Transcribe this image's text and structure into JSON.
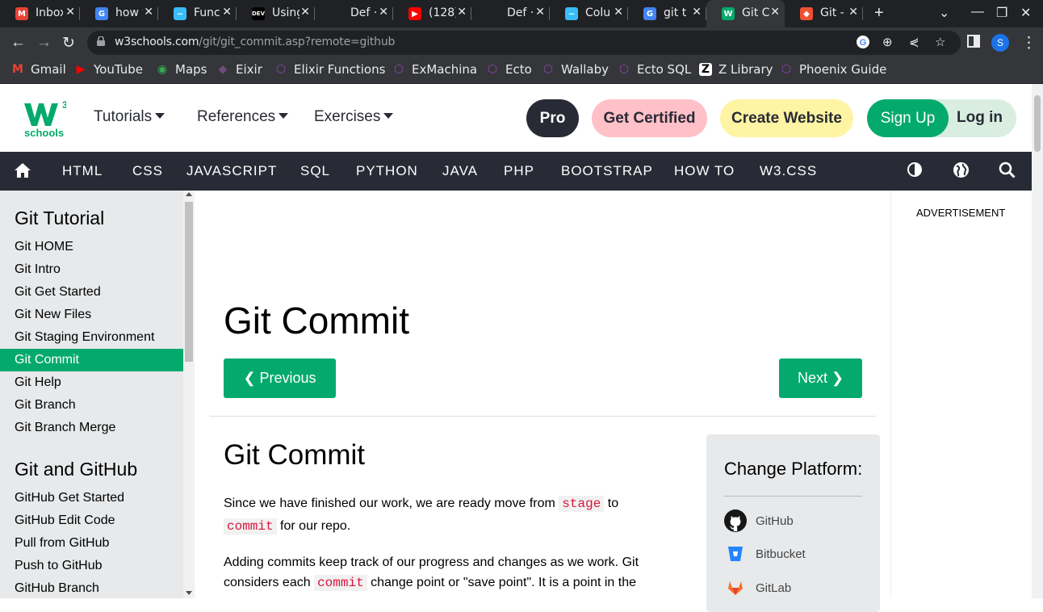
{
  "browser": {
    "tabs": [
      {
        "title": "Inbox",
        "favicon": "gmail-icon",
        "color": "#ea4335",
        "glyph": "M"
      },
      {
        "title": "how t",
        "favicon": "google-icon",
        "color": "#4285f4",
        "glyph": "G"
      },
      {
        "title": "Func",
        "favicon": "tailwind-icon",
        "color": "#38bdf8",
        "glyph": "~"
      },
      {
        "title": "Using",
        "favicon": "dev-icon",
        "color": "#000000",
        "glyph": "DEV"
      },
      {
        "title": "Def ·",
        "favicon": "blank-icon",
        "color": "#202124",
        "glyph": ""
      },
      {
        "title": "(128)",
        "favicon": "youtube-icon",
        "color": "#ff0000",
        "glyph": "▶"
      },
      {
        "title": "Def ·",
        "favicon": "blank-icon",
        "color": "#202124",
        "glyph": ""
      },
      {
        "title": "Colu",
        "favicon": "tailwind-icon",
        "color": "#38bdf8",
        "glyph": "~"
      },
      {
        "title": "git t",
        "favicon": "google-icon",
        "color": "#4285f4",
        "glyph": "G"
      },
      {
        "title": "Git C",
        "favicon": "w3schools-icon",
        "color": "#04aa6d",
        "glyph": "W",
        "active": true
      },
      {
        "title": "Git -",
        "favicon": "git-icon",
        "color": "#f05033",
        "glyph": "◆"
      }
    ],
    "url_domain": "w3schools.com",
    "url_path": "/git/git_commit.asp?remote=github",
    "profile_initial": "S",
    "bookmarks": [
      {
        "label": "Gmail",
        "icon": "gmail-icon",
        "color": "#ea4335",
        "glyph": "M"
      },
      {
        "label": "YouTube",
        "icon": "youtube-icon",
        "color": "#ff0000",
        "glyph": "▶"
      },
      {
        "label": "Maps",
        "icon": "maps-icon",
        "color": "#34a853",
        "glyph": "◉"
      },
      {
        "label": "Eixir",
        "icon": "elixir-icon",
        "color": "#6e4a7e",
        "glyph": "◆"
      },
      {
        "label": "Elixir Functions",
        "icon": "hexdocs-icon",
        "color": "#8e44ad",
        "glyph": "⬡"
      },
      {
        "label": "ExMachina",
        "icon": "hexdocs-icon",
        "color": "#8e44ad",
        "glyph": "⬡"
      },
      {
        "label": "Ecto",
        "icon": "hexdocs-icon",
        "color": "#8e44ad",
        "glyph": "⬡"
      },
      {
        "label": "Wallaby",
        "icon": "hexdocs-icon",
        "color": "#8e44ad",
        "glyph": "⬡"
      },
      {
        "label": "Ecto SQL",
        "icon": "hexdocs-icon",
        "color": "#8e44ad",
        "glyph": "⬡"
      },
      {
        "label": "Z Library",
        "icon": "zlibrary-icon",
        "color": "#ffffff",
        "glyph": "Z"
      },
      {
        "label": "Phoenix Guide",
        "icon": "hexdocs-icon",
        "color": "#8e44ad",
        "glyph": "⬡"
      }
    ]
  },
  "header": {
    "logo_text": "schools",
    "logo_sup": "3",
    "menus": [
      "Tutorials",
      "References",
      "Exercises"
    ],
    "pro": "Pro",
    "get_certified": "Get Certified",
    "create_website": "Create Website",
    "sign_up": "Sign Up",
    "log_in": "Log in"
  },
  "topnav": [
    "HTML",
    "CSS",
    "JAVASCRIPT",
    "SQL",
    "PYTHON",
    "JAVA",
    "PHP",
    "BOOTSTRAP",
    "HOW TO",
    "W3.CSS"
  ],
  "sidebar": {
    "section1": "Git Tutorial",
    "items1": [
      "Git HOME",
      "Git Intro",
      "Git Get Started",
      "Git New Files",
      "Git Staging Environment",
      "Git Commit",
      "Git Help",
      "Git Branch",
      "Git Branch Merge"
    ],
    "active_index": 5,
    "section2": "Git and GitHub",
    "items2": [
      "GitHub Get Started",
      "GitHub Edit Code",
      "Pull from GitHub",
      "Push to GitHub",
      "GitHub Branch"
    ]
  },
  "main": {
    "title": "Git Commit",
    "prev": "❮ Previous",
    "next": "Next ❯",
    "section_title": "Git Commit",
    "p1_a": "Since we have finished our work, we are ready move from ",
    "p1_code1": "stage",
    "p1_b": " to",
    "p1_code2": "commit",
    "p1_c": " for our repo.",
    "p2_a": "Adding commits keep track of our progress and changes as we work. Git considers each ",
    "p2_code": "commit",
    "p2_b": " change point or \"save point\". It is a point in the"
  },
  "platform": {
    "title": "Change Platform:",
    "options": [
      "GitHub",
      "Bitbucket",
      "GitLab"
    ]
  },
  "ad_label": "ADVERTISEMENT",
  "colors": {
    "accent": "#04aa6d",
    "dark": "#282a35",
    "pink": "#ffc0c7",
    "yellow": "#fff4a3"
  }
}
